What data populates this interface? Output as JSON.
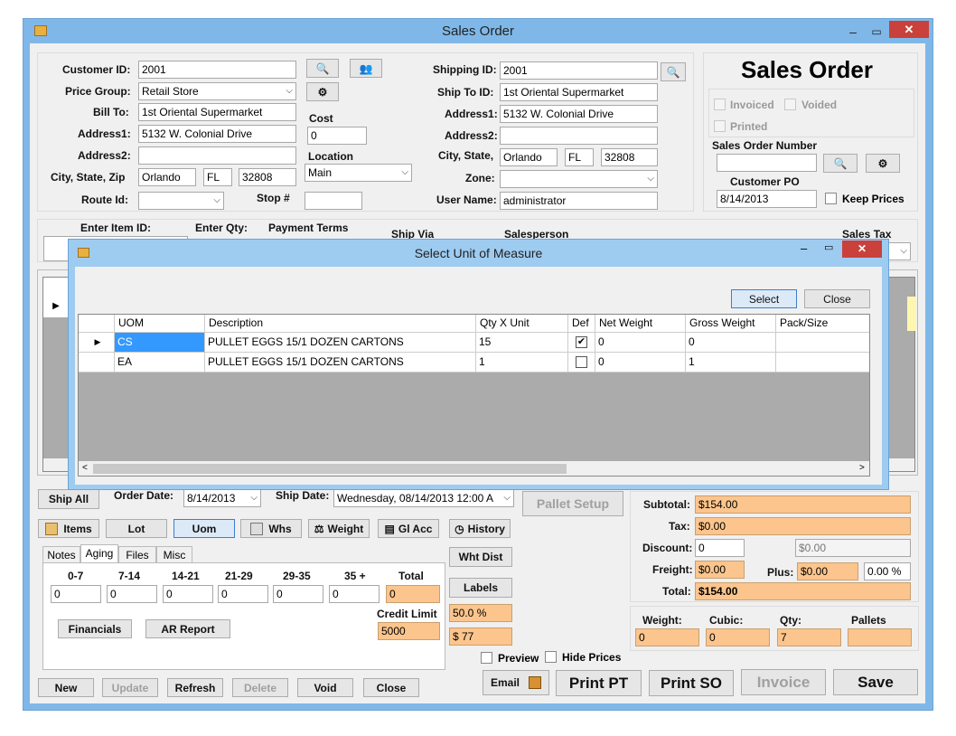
{
  "window": {
    "title": "Sales Order",
    "min": "–",
    "max": "▭",
    "close": "✕"
  },
  "header": {
    "customer_id_label": "Customer ID:",
    "customer_id": "2001",
    "price_group_label": "Price Group:",
    "price_group": "Retail Store",
    "bill_to_label": "Bill To:",
    "bill_to": "1st Oriental Supermarket",
    "address1_label": "Address1:",
    "address1": "5132 W. Colonial Drive",
    "address2_label": "Address2:",
    "address2": "",
    "city_label": "City, State, Zip",
    "city": "Orlando",
    "state": "FL",
    "zip": "32808",
    "route_label": "Route Id:",
    "route": "",
    "cost_label": "Cost",
    "cost": "0",
    "location_label": "Location",
    "location": "Main",
    "stop_label": "Stop #",
    "stop": "",
    "shipping_id_label": "Shipping ID:",
    "shipping_id": "2001",
    "ship_to_label": "Ship To ID:",
    "ship_to": "1st Oriental Supermarket",
    "s_address1_label": "Address1:",
    "s_address1": "5132 W. Colonial Drive",
    "s_address2_label": "Address2:",
    "s_address2": "",
    "s_city_label": "City, State,",
    "s_city": "Orlando",
    "s_state": "FL",
    "s_zip": "32808",
    "zone_label": "Zone:",
    "zone": "",
    "user_label": "User Name:",
    "user": "administrator"
  },
  "status_panel": {
    "title": "Sales Order",
    "invoiced": "Invoiced",
    "voided": "Voided",
    "printed": "Printed",
    "so_number_label": "Sales Order Number",
    "so_number": "",
    "customer_po_label": "Customer PO",
    "customer_po": "8/14/2013",
    "keep_prices": "Keep Prices"
  },
  "entry_bar": {
    "item_label": "Enter Item ID:",
    "qty_label": "Enter Qty:",
    "terms_label": "Payment Terms",
    "ship_via_label": "Ship Via",
    "salesperson_label": "Salesperson",
    "sales_tax_label": "Sales Tax"
  },
  "dialog": {
    "title": "Select Unit of Measure",
    "select": "Select",
    "close": "Close",
    "columns": [
      "UOM",
      "Description",
      "Qty X Unit",
      "Def",
      "Net Weight",
      "Gross Weight",
      "Pack/Size"
    ],
    "rows": [
      {
        "uom": "CS",
        "desc": "PULLET EGGS 15/1 DOZEN CARTONS",
        "qty": "15",
        "def": "✔",
        "net": "0",
        "gross": "0",
        "pack": ""
      },
      {
        "uom": "EA",
        "desc": "PULLET EGGS 15/1 DOZEN CARTONS",
        "qty": "1",
        "def": "",
        "net": "0",
        "gross": "1",
        "pack": ""
      }
    ]
  },
  "mid": {
    "ship_all": "Ship All",
    "order_date_label": "Order Date:",
    "order_date": "8/14/2013",
    "ship_date_label": "Ship Date:",
    "ship_date": "Wednesday, 08/14/2013 12:00 A",
    "pallet_setup": "Pallet Setup",
    "items": "Items",
    "lot": "Lot",
    "uom": "Uom",
    "whs": "Whs",
    "weight": "Weight",
    "gl_acc": "Gl Acc",
    "history": "History",
    "wht_dist": "Wht Dist",
    "labels": "Labels",
    "pct": "50.0 %",
    "amt": "$ 77"
  },
  "tabs": [
    "Notes",
    "Aging",
    "Files",
    "Misc"
  ],
  "aging": {
    "headers": [
      "0-7",
      "7-14",
      "14-21",
      "21-29",
      "29-35",
      "35 +",
      "Total"
    ],
    "values": [
      "0",
      "0",
      "0",
      "0",
      "0",
      "0",
      "0"
    ],
    "credit_label": "Credit Limit",
    "credit": "5000",
    "financials": "Financials",
    "ar_report": "AR Report"
  },
  "totals": {
    "subtotal_label": "Subtotal:",
    "subtotal": "$154.00",
    "tax_label": "Tax:",
    "tax": "$0.00",
    "discount_label": "Discount:",
    "discount": "0",
    "discount_amt": "$0.00",
    "freight_label": "Freight:",
    "freight": "$0.00",
    "plus_label": "Plus:",
    "plus": "$0.00",
    "plus_pct": "0.00 %",
    "total_label": "Total:",
    "total": "$154.00"
  },
  "weights": {
    "weight_label": "Weight:",
    "weight": "0",
    "cubic_label": "Cubic:",
    "cubic": "0",
    "qty_label": "Qty:",
    "qty": "7",
    "pallets_label": "Pallets",
    "pallets": ""
  },
  "bottom": {
    "new": "New",
    "update": "Update",
    "refresh": "Refresh",
    "delete": "Delete",
    "void": "Void",
    "close": "Close",
    "preview": "Preview",
    "hide_prices": "Hide Prices",
    "email": "Email",
    "print_pt": "Print PT",
    "print_so": "Print SO",
    "invoice": "Invoice",
    "save": "Save"
  }
}
